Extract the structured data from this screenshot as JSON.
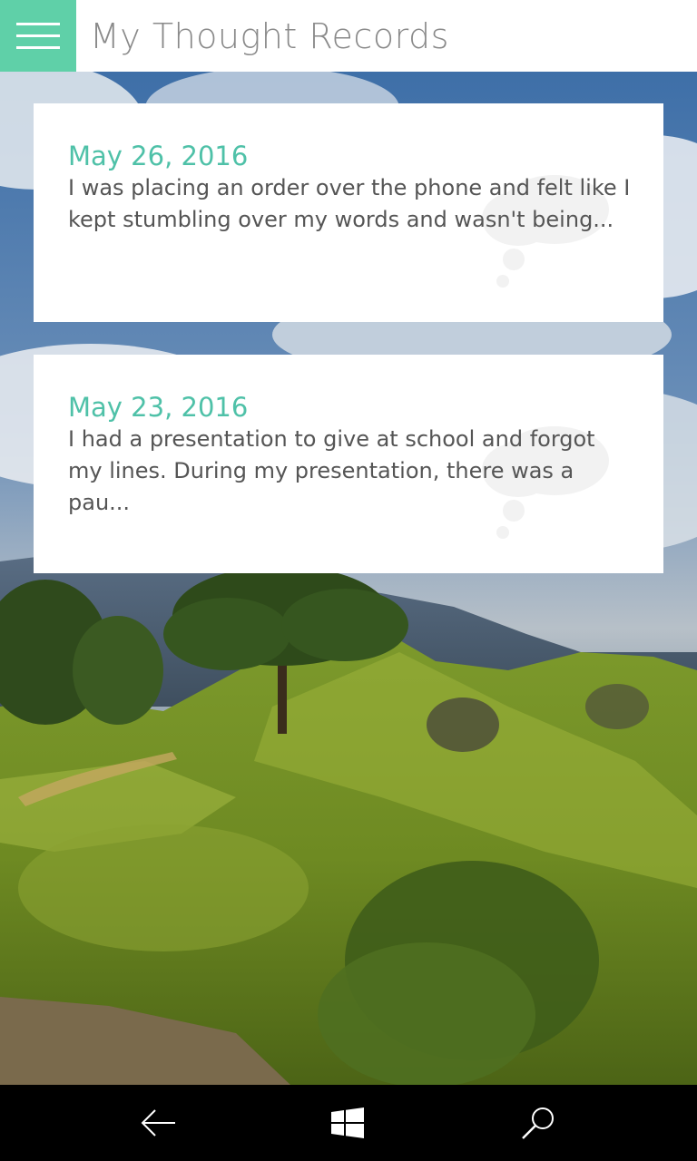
{
  "header": {
    "title": "My Thought Records",
    "menu_icon": "hamburger-menu-icon",
    "accent": "#5fd0a8"
  },
  "records": [
    {
      "date": "May 26, 2016",
      "preview": "I was placing an order over the phone and felt like I kept stumbling over my words and wasn't being..."
    },
    {
      "date": "May 23, 2016",
      "preview": "I had a presentation to give at school and forgot my lines. During my presentation, there was a pau..."
    }
  ],
  "nav_bar": {
    "back_icon": "back-arrow-icon",
    "home_icon": "windows-logo-icon",
    "search_icon": "search-icon"
  },
  "colors": {
    "date_color": "#4fc1a8",
    "text_color": "#555555"
  }
}
